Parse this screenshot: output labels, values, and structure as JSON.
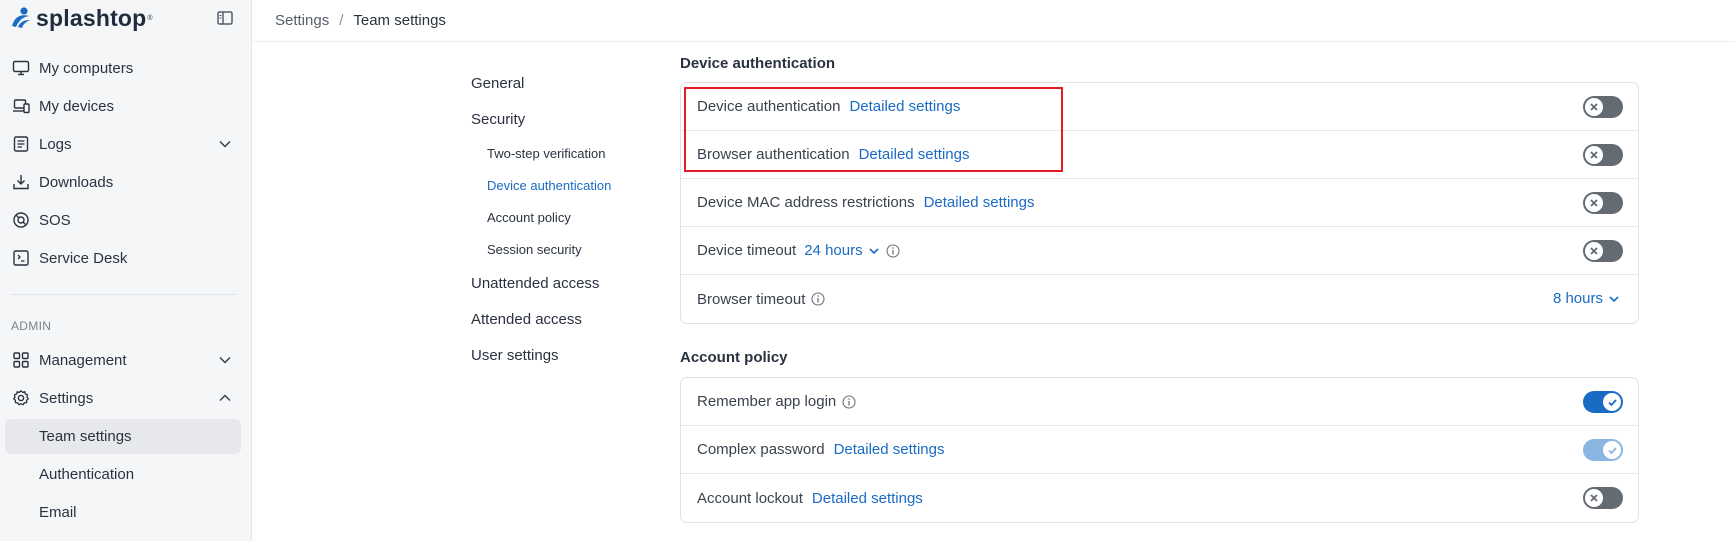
{
  "brand": {
    "name": "splashtop",
    "trademark": "®"
  },
  "sidebar": {
    "items": [
      {
        "label": "My computers",
        "icon": "monitor-icon"
      },
      {
        "label": "My devices",
        "icon": "devices-icon"
      },
      {
        "label": "Logs",
        "icon": "logs-icon"
      },
      {
        "label": "Downloads",
        "icon": "download-icon"
      },
      {
        "label": "SOS",
        "icon": "sos-icon"
      },
      {
        "label": "Service Desk",
        "icon": "service-desk-icon"
      }
    ],
    "admin_label": "ADMIN",
    "admin_items": [
      {
        "label": "Management",
        "icon": "grid-icon"
      },
      {
        "label": "Settings",
        "icon": "gear-icon"
      }
    ],
    "settings_children": [
      {
        "label": "Team settings",
        "active": true
      },
      {
        "label": "Authentication",
        "active": false
      },
      {
        "label": "Email",
        "active": false
      }
    ]
  },
  "breadcrumb": {
    "parent": "Settings",
    "separator": "/",
    "current": "Team settings"
  },
  "subnav": {
    "general": "General",
    "security": "Security",
    "security_children": [
      {
        "label": "Two-step verification",
        "active": false
      },
      {
        "label": "Device authentication",
        "active": true
      },
      {
        "label": "Account policy",
        "active": false
      },
      {
        "label": "Session security",
        "active": false
      }
    ],
    "unattended": "Unattended access",
    "attended": "Attended access",
    "user_settings": "User settings"
  },
  "device_auth": {
    "title": "Device authentication",
    "rows": [
      {
        "label": "Device authentication",
        "link": "Detailed settings",
        "toggle": "off"
      },
      {
        "label": "Browser authentication",
        "link": "Detailed settings",
        "toggle": "off"
      },
      {
        "label": "Device MAC address restrictions",
        "link": "Detailed settings",
        "toggle": "off"
      },
      {
        "label": "Device timeout",
        "dropdown": "24 hours",
        "toggle": "off"
      },
      {
        "label": "Browser timeout",
        "dropdown": "8 hours"
      }
    ]
  },
  "account_policy": {
    "title": "Account policy",
    "rows": [
      {
        "label": "Remember app login",
        "toggle": "on"
      },
      {
        "label": "Complex password",
        "link": "Detailed settings",
        "toggle": "on-disabled"
      },
      {
        "label": "Account lockout",
        "link": "Detailed settings",
        "toggle": "off"
      }
    ]
  },
  "colors": {
    "accent": "#1a6bc4",
    "highlight": "#e21b24",
    "toggle_off": "#656b73"
  }
}
